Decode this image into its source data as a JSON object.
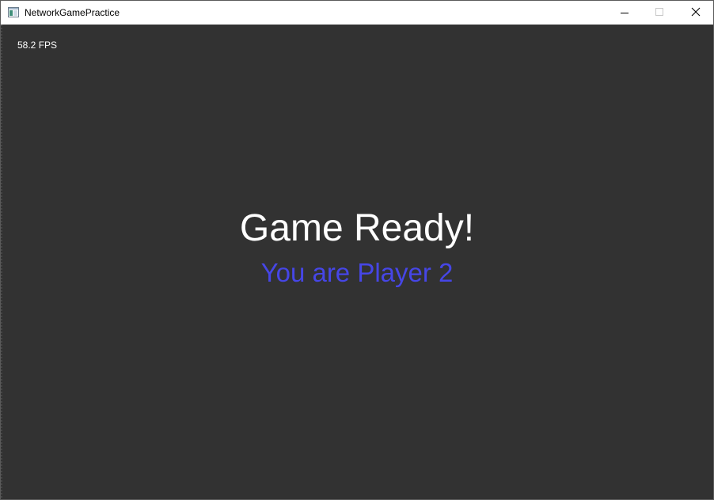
{
  "window": {
    "title": "NetworkGamePractice",
    "app_icon": "application-window-icon",
    "controls": {
      "minimize_icon": "minimize-icon",
      "maximize_icon": "maximize-icon",
      "close_icon": "close-icon"
    }
  },
  "game": {
    "fps_text": "58.2 FPS",
    "status_title": "Game Ready!",
    "player_label": "You are Player 2",
    "colors": {
      "background": "#323232",
      "title_text": "#ffffff",
      "player_text": "#4646e6"
    }
  }
}
